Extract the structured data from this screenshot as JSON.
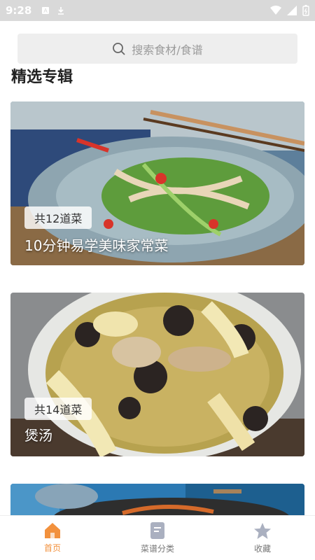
{
  "status": {
    "time": "9:28"
  },
  "search": {
    "placeholder": "搜索食材/食谱"
  },
  "section": {
    "title": "精选专辑"
  },
  "albums": [
    {
      "count": "共12道菜",
      "title": "10分钟易学美味家常菜"
    },
    {
      "count": "共14道菜",
      "title": "煲汤"
    },
    {
      "count": "",
      "title": ""
    }
  ],
  "tabs": [
    {
      "label": "首页",
      "icon": "home-icon",
      "active": true
    },
    {
      "label": "菜谱分类",
      "icon": "recipe-book-icon",
      "active": false
    },
    {
      "label": "收藏",
      "icon": "star-icon",
      "active": false
    }
  ],
  "colors": {
    "accent": "#f2913d",
    "inactive": "#aab0c0"
  }
}
